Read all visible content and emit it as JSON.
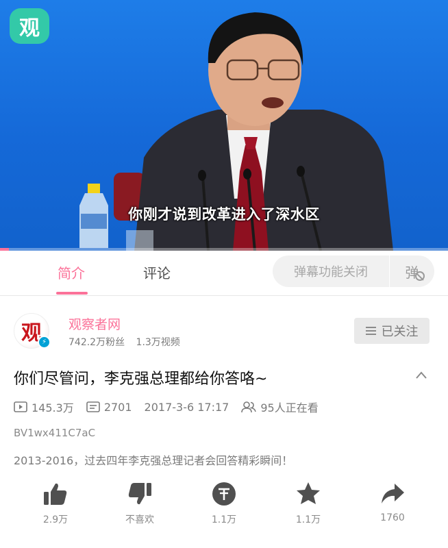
{
  "video": {
    "logo_char": "观",
    "subtitle": "你刚才说到改革进入了深水区",
    "progress_fraction": 0.02
  },
  "tabs": {
    "intro": "简介",
    "comments": "评论",
    "danmaku_label": "弹幕功能关闭",
    "danmaku_icon_char": "弹"
  },
  "uploader": {
    "avatar_char": "观",
    "verified_icon": "lightning-icon",
    "name": "观察者网",
    "fans": "742.2万粉丝",
    "videos": "1.3万视频",
    "follow_label": "已关注"
  },
  "video_info": {
    "title": "你们尽管问，李克强总理都给你答咯~",
    "views": "145.3万",
    "danmaku_count": "2701",
    "datetime": "2017-3-6 17:17",
    "watching": "95人正在看",
    "bvid": "BV1wx411C7aC",
    "description": "2013-2016，过去四年李克强总理记者会回答精彩瞬间！"
  },
  "actions": {
    "like": "2.9万",
    "dislike": "不喜欢",
    "coin": "1.1万",
    "favorite": "1.1万",
    "share": "1760"
  },
  "colors": {
    "accent": "#fb7299",
    "video_bg": "#1569d8",
    "icon": "#505050",
    "muted_text": "#7a7a7a"
  }
}
